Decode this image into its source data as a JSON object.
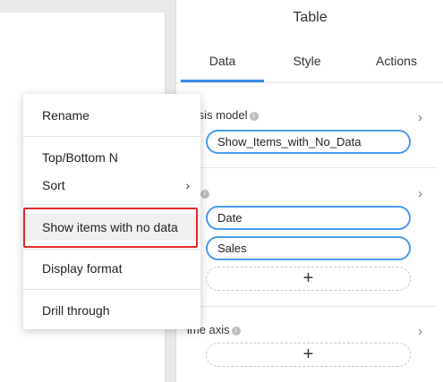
{
  "panel": {
    "title": "Table",
    "tabs": [
      {
        "label": "Data",
        "active": true
      },
      {
        "label": "Style",
        "active": false
      },
      {
        "label": "Actions",
        "active": false
      }
    ],
    "analysis_model": {
      "label": "alysis model",
      "value": "Show_Items_with_No_Data"
    },
    "fields": {
      "label": "lds",
      "items": [
        "Date",
        "Sales"
      ],
      "add_symbol": "+"
    },
    "time_axis": {
      "label": "ime axis",
      "add_symbol": "+"
    },
    "info_symbol": "i",
    "chevron": "›"
  },
  "context_menu": {
    "items": [
      {
        "label": "Rename"
      },
      {
        "label": "Top/Bottom N"
      },
      {
        "label": "Sort",
        "has_submenu": true
      },
      {
        "label": "Show items with no data",
        "highlighted": true
      },
      {
        "label": "Display format"
      },
      {
        "label": "Drill through"
      }
    ],
    "submenu_chevron": "›"
  },
  "colors": {
    "accent": "#3a8ee6",
    "pill_border": "#4a9af0",
    "highlight_box": "#e02b2b"
  }
}
